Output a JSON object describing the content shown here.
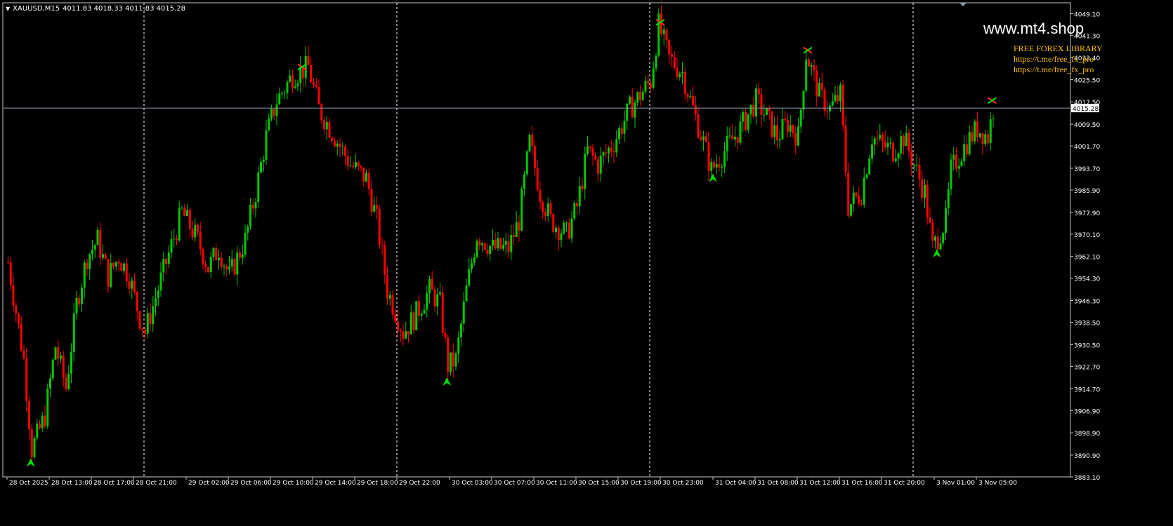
{
  "chart_info": {
    "symbol": "XAUUSD,M15",
    "ohlc": "4011.83 4018.33 4011.83 4015.28",
    "dropdown_glyph": "▼"
  },
  "watermark": {
    "site": "www.mt4.shop",
    "library_title": "FREE FOREX LIBRARY",
    "links": [
      "https://t.me/free_fx_pro",
      "https://t.me/free_fx_pro"
    ]
  },
  "colors": {
    "background": "#000000",
    "bull": "#00c800",
    "bear": "#ff0000",
    "grid": "#c8c8c8",
    "price_line": "#8c9aa8",
    "accent": "#ffc000",
    "signal_up": "#00e000",
    "signal_down": "#ff3030"
  },
  "chart_data": {
    "type": "candlestick",
    "ylim": [
      3883.1,
      4053.0
    ],
    "y_ticks": [
      "4049.10",
      "4041.30",
      "4033.40",
      "4025.50",
      "4017.50",
      "4009.50",
      "4001.70",
      "3993.70",
      "3985.90",
      "3977.90",
      "3970.10",
      "3962.10",
      "3954.30",
      "3946.30",
      "3938.50",
      "3930.50",
      "3922.70",
      "3914.70",
      "3906.90",
      "3898.90",
      "3890.90",
      "3883.10"
    ],
    "current_price": "4015.28",
    "x_tick_labels": [
      "28 Oct 2025",
      "28 Oct 13:00",
      "28 Oct 17:00",
      "28 Oct 21:00",
      "29 Oct 02:00",
      "29 Oct 06:00",
      "29 Oct 10:00",
      "29 Oct 14:00",
      "29 Oct 18:00",
      "29 Oct 22:00",
      "30 Oct 03:00",
      "30 Oct 07:00",
      "30 Oct 11:00",
      "30 Oct 15:00",
      "30 Oct 19:00",
      "30 Oct 23:00",
      "31 Oct 04:00",
      "31 Oct 08:00",
      "31 Oct 12:00",
      "31 Oct 16:00",
      "31 Oct 20:00",
      "3 Nov 01:00",
      "3 Nov 05:00"
    ],
    "day_separators": [
      "28 Oct 22:00",
      "29 Oct 22:00",
      "30 Oct 22:00",
      "31 Oct 23:00"
    ],
    "price_path": [
      [
        "28 Oct 2025",
        3960
      ],
      [
        "28 Oct 10:30",
        3925
      ],
      [
        "28 Oct 11:15",
        3893
      ],
      [
        "28 Oct 12:30",
        3905
      ],
      [
        "28 Oct 13:30",
        3930
      ],
      [
        "28 Oct 14:30",
        3915
      ],
      [
        "28 Oct 15:30",
        3945
      ],
      [
        "28 Oct 16:30",
        3962
      ],
      [
        "28 Oct 17:30",
        3968
      ],
      [
        "28 Oct 18:30",
        3955
      ],
      [
        "28 Oct 19:30",
        3962
      ],
      [
        "28 Oct 20:30",
        3955
      ],
      [
        "28 Oct 21:30",
        3940
      ],
      [
        "28 Oct 22:00",
        3935
      ],
      [
        "29 Oct 00:00",
        3960
      ],
      [
        "29 Oct 01:30",
        3978
      ],
      [
        "29 Oct 03:00",
        3968
      ],
      [
        "29 Oct 04:00",
        3958
      ],
      [
        "29 Oct 05:00",
        3965
      ],
      [
        "29 Oct 06:00",
        3955
      ],
      [
        "29 Oct 07:30",
        3968
      ],
      [
        "29 Oct 08:30",
        3985
      ],
      [
        "29 Oct 09:30",
        4005
      ],
      [
        "29 Oct 10:30",
        4018
      ],
      [
        "29 Oct 12:00",
        4027
      ],
      [
        "29 Oct 13:30",
        4030
      ],
      [
        "29 Oct 14:30",
        4015
      ],
      [
        "29 Oct 16:00",
        4005
      ],
      [
        "29 Oct 17:30",
        3995
      ],
      [
        "29 Oct 19:00",
        3990
      ],
      [
        "29 Oct 20:00",
        3975
      ],
      [
        "29 Oct 21:00",
        3950
      ],
      [
        "29 Oct 22:30",
        3935
      ],
      [
        "29 Oct 23:30",
        3940
      ],
      [
        "30 Oct 01:00",
        3950
      ],
      [
        "30 Oct 02:00",
        3945
      ],
      [
        "30 Oct 02:45",
        3923
      ],
      [
        "30 Oct 03:30",
        3925
      ],
      [
        "30 Oct 04:30",
        3950
      ],
      [
        "30 Oct 05:30",
        3970
      ],
      [
        "30 Oct 07:00",
        3965
      ],
      [
        "30 Oct 08:30",
        3965
      ],
      [
        "30 Oct 09:30",
        3975
      ],
      [
        "30 Oct 10:30",
        4003
      ],
      [
        "30 Oct 11:30",
        3985
      ],
      [
        "30 Oct 12:30",
        3975
      ],
      [
        "30 Oct 14:00",
        3970
      ],
      [
        "30 Oct 15:00",
        3980
      ],
      [
        "30 Oct 16:00",
        4000
      ],
      [
        "30 Oct 17:00",
        3995
      ],
      [
        "30 Oct 18:30",
        4003
      ],
      [
        "30 Oct 20:00",
        4015
      ],
      [
        "30 Oct 21:00",
        4020
      ],
      [
        "30 Oct 22:00",
        4025
      ],
      [
        "30 Oct 22:45",
        4045
      ],
      [
        "30 Oct 23:45",
        4033
      ],
      [
        "31 Oct 01:00",
        4028
      ],
      [
        "31 Oct 02:00",
        4015
      ],
      [
        "31 Oct 03:00",
        4003
      ],
      [
        "31 Oct 03:45",
        3993
      ],
      [
        "31 Oct 05:00",
        4000
      ],
      [
        "31 Oct 06:30",
        4008
      ],
      [
        "31 Oct 08:00",
        4018
      ],
      [
        "31 Oct 09:00",
        4012
      ],
      [
        "31 Oct 10:00",
        4005
      ],
      [
        "31 Oct 11:00",
        4010
      ],
      [
        "31 Oct 12:00",
        4005
      ],
      [
        "31 Oct 12:45",
        4035
      ],
      [
        "31 Oct 14:00",
        4020
      ],
      [
        "31 Oct 15:00",
        4015
      ],
      [
        "31 Oct 16:00",
        4020
      ],
      [
        "31 Oct 16:45",
        3980
      ],
      [
        "31 Oct 18:00",
        3985
      ],
      [
        "31 Oct 19:00",
        4005
      ],
      [
        "31 Oct 20:00",
        4002
      ],
      [
        "31 Oct 21:00",
        4000
      ],
      [
        "31 Oct 22:00",
        4005
      ],
      [
        "31 Oct 23:00",
        3995
      ],
      [
        "3 Nov 00:00",
        3985
      ],
      [
        "3 Nov 00:45",
        3965
      ],
      [
        "3 Nov 02:00",
        3975
      ],
      [
        "3 Nov 02:30",
        3993
      ],
      [
        "3 Nov 04:00",
        4003
      ],
      [
        "3 Nov 05:00",
        4008
      ],
      [
        "3 Nov 06:00",
        4005
      ],
      [
        "3 Nov 06:30",
        4015
      ]
    ],
    "signals": [
      {
        "dir": "up",
        "time": "28 Oct 11:15",
        "price": 3888
      },
      {
        "dir": "down",
        "time": "29 Oct 13:00",
        "price": 4030
      },
      {
        "dir": "up",
        "time": "30 Oct 02:45",
        "price": 3917
      },
      {
        "dir": "down",
        "time": "30 Oct 23:00",
        "price": 4046
      },
      {
        "dir": "up",
        "time": "31 Oct 04:00",
        "price": 3990
      },
      {
        "dir": "down",
        "time": "31 Oct 13:00",
        "price": 4036
      },
      {
        "dir": "up",
        "time": "3 Nov 01:15",
        "price": 3963
      },
      {
        "dir": "down",
        "time": "3 Nov 06:30",
        "price": 4018
      }
    ]
  }
}
